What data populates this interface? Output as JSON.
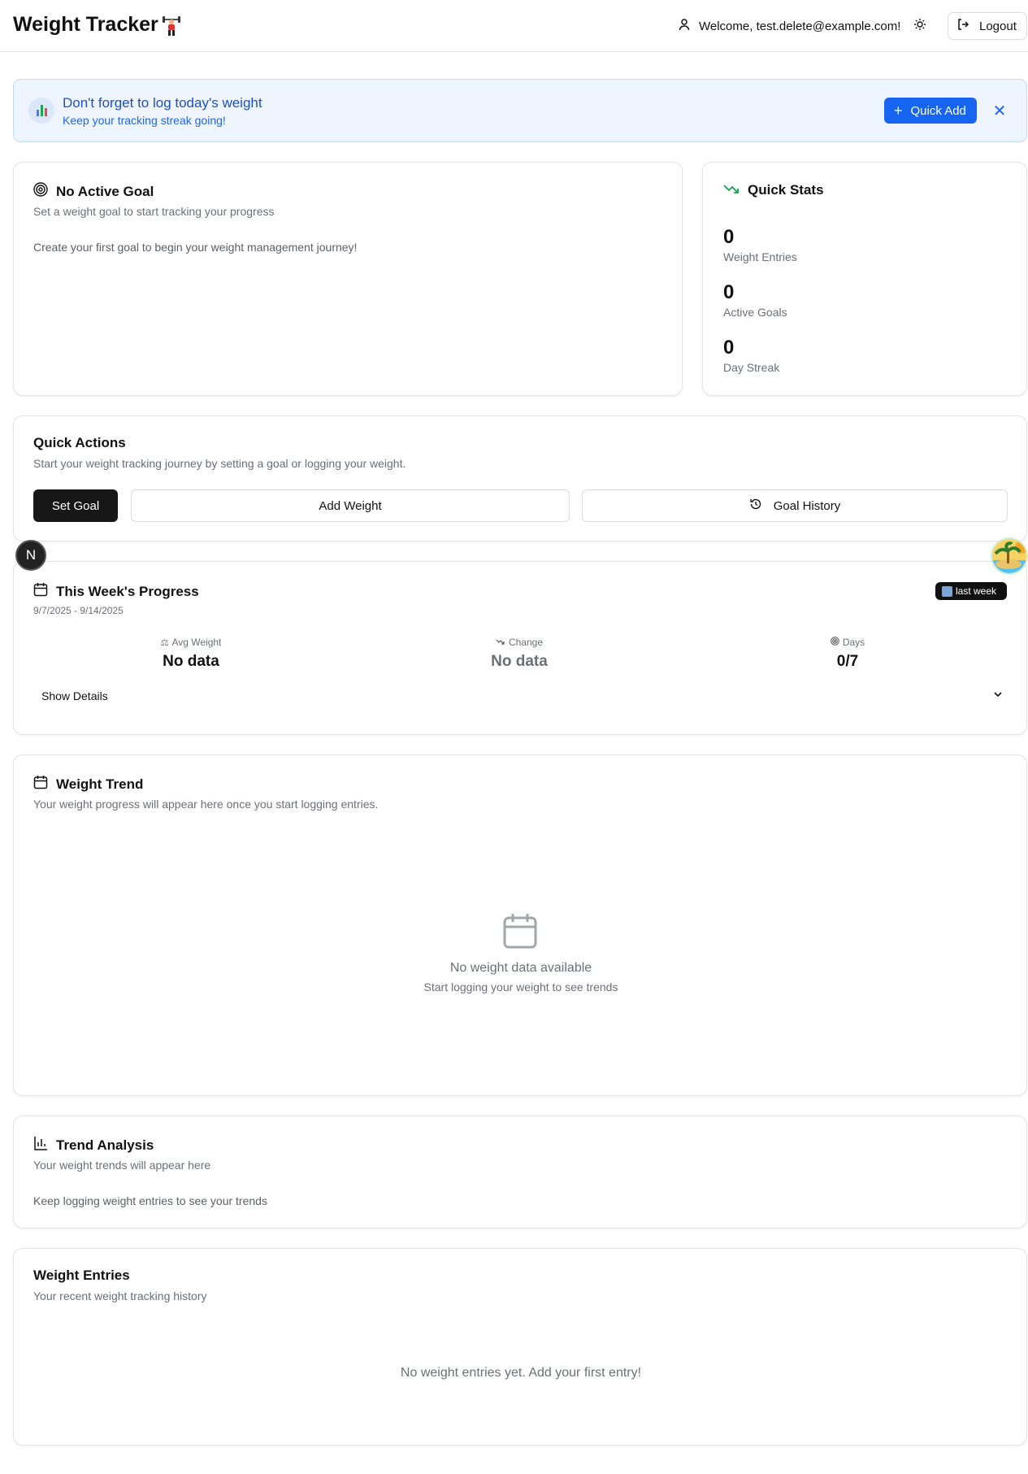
{
  "header": {
    "app_title": "Weight Tracker",
    "welcome": "Welcome, test.delete@example.com!",
    "logout_label": "Logout"
  },
  "banner": {
    "title": "Don't forget to log today's weight",
    "subtitle": "Keep your tracking streak going!",
    "quick_add_label": "Quick Add"
  },
  "goal_card": {
    "title": "No Active Goal",
    "subtitle": "Set a weight goal to start tracking your progress",
    "body": "Create your first goal to begin your weight management journey!"
  },
  "quick_stats": {
    "title": "Quick Stats",
    "stats": [
      {
        "value": "0",
        "label": "Weight Entries"
      },
      {
        "value": "0",
        "label": "Active Goals"
      },
      {
        "value": "0",
        "label": "Day Streak"
      }
    ]
  },
  "quick_actions": {
    "title": "Quick Actions",
    "subtitle": "Start your weight tracking journey by setting a goal or logging your weight.",
    "set_goal_label": "Set Goal",
    "add_weight_label": "Add Weight",
    "goal_history_label": "Goal History"
  },
  "floating": {
    "n_badge": "N"
  },
  "week_progress": {
    "title": "This Week's Progress",
    "date_range": "9/7/2025 - 9/14/2025",
    "pill_label": "last week",
    "columns": [
      {
        "label": "Avg Weight",
        "value": "No data"
      },
      {
        "label": "Change",
        "value": "No data"
      },
      {
        "label": "Days",
        "value": "0/7"
      }
    ],
    "show_details_label": "Show Details"
  },
  "weight_trend": {
    "title": "Weight Trend",
    "subtitle": "Your weight progress will appear here once you start logging entries.",
    "empty_title": "No weight data available",
    "empty_sub": "Start logging your weight to see trends"
  },
  "trend_analysis": {
    "title": "Trend Analysis",
    "subtitle": "Your weight trends will appear here",
    "body": "Keep logging weight entries to see your trends"
  },
  "weight_entries": {
    "title": "Weight Entries",
    "subtitle": "Your recent weight tracking history",
    "empty": "No weight entries yet. Add your first entry!"
  },
  "colors": {
    "accent_blue": "#1664f0",
    "banner_bg": "#eef5ff",
    "primary_dark": "#171717",
    "trend_green": "#16a34a"
  }
}
